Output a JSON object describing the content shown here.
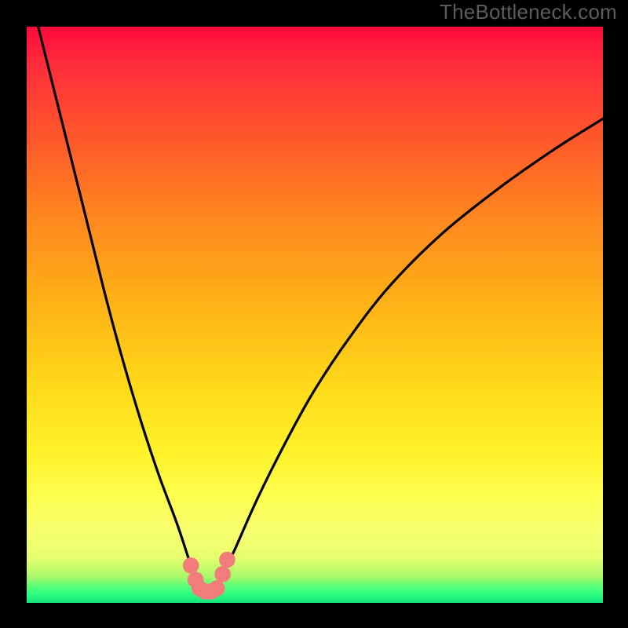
{
  "watermark": {
    "text": "TheBottleneck.com"
  },
  "chart_data": {
    "type": "line",
    "title": "",
    "xlabel": "",
    "ylabel": "",
    "xlim": [
      0,
      100
    ],
    "ylim": [
      0,
      100
    ],
    "background_gradient_meaning": "red=high bottleneck, green=no bottleneck",
    "series": [
      {
        "name": "bottleneck-curve",
        "x": [
          2,
          5,
          8,
          11,
          14,
          17,
          20,
          23,
          26,
          28,
          29,
          30,
          31,
          32,
          33,
          34,
          36,
          40,
          45,
          50,
          56,
          63,
          72,
          82,
          92,
          100
        ],
        "y": [
          100,
          88,
          76,
          64,
          52,
          41,
          31,
          22,
          14,
          8,
          5,
          3,
          2,
          2,
          3,
          5,
          9,
          18,
          28,
          37,
          46,
          55,
          64,
          72,
          79,
          84
        ]
      }
    ],
    "markers": [
      {
        "x": 28.5,
        "y": 6.5,
        "r": 1.4,
        "color": "#f27b7b"
      },
      {
        "x": 29.3,
        "y": 4.0,
        "r": 1.4,
        "color": "#f27b7b"
      },
      {
        "x": 30.0,
        "y": 2.5,
        "r": 1.4,
        "color": "#f27b7b"
      },
      {
        "x": 31.0,
        "y": 2.0,
        "r": 1.4,
        "color": "#f27b7b"
      },
      {
        "x": 32.0,
        "y": 2.0,
        "r": 1.4,
        "color": "#f27b7b"
      },
      {
        "x": 33.0,
        "y": 2.5,
        "r": 1.4,
        "color": "#f27b7b"
      },
      {
        "x": 34.0,
        "y": 5.0,
        "r": 1.4,
        "color": "#f27b7b"
      },
      {
        "x": 34.8,
        "y": 7.5,
        "r": 1.4,
        "color": "#f27b7b"
      }
    ]
  }
}
